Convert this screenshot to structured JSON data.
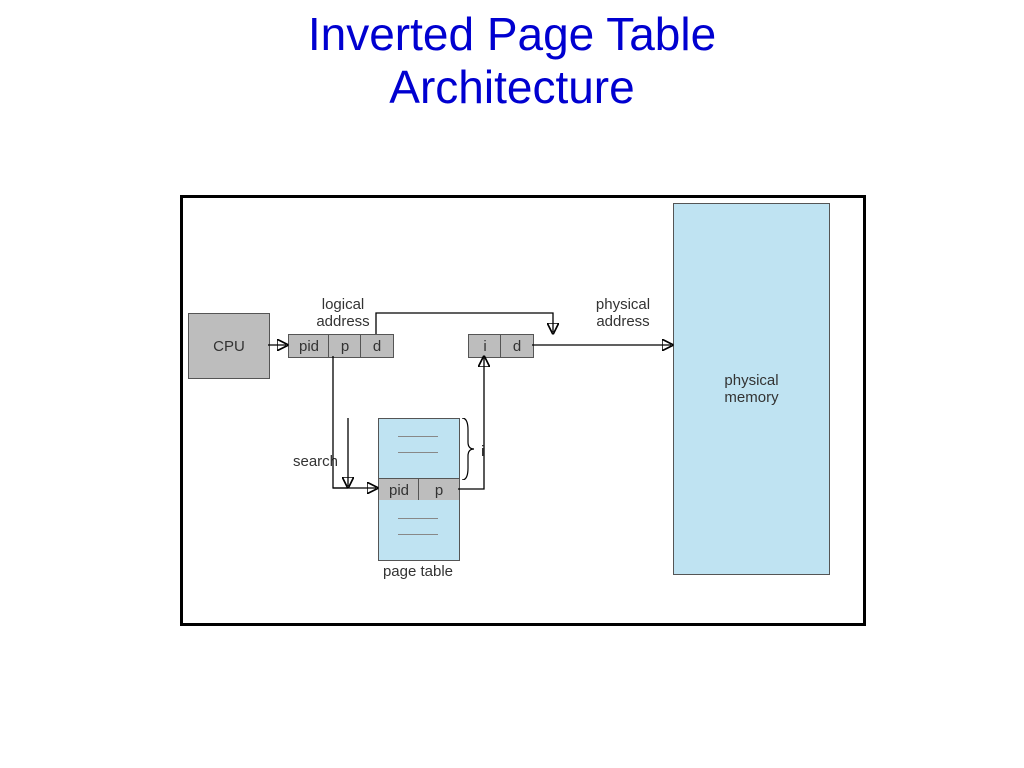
{
  "title_line1": "Inverted Page Table",
  "title_line2": "Architecture",
  "labels": {
    "cpu": "CPU",
    "logical": "logical\naddress",
    "physical": "physical\naddress",
    "physmem": "physical\nmemory",
    "search": "search",
    "pagetable": "page table",
    "i": "i",
    "pid": "pid",
    "p": "p",
    "d": "d"
  }
}
